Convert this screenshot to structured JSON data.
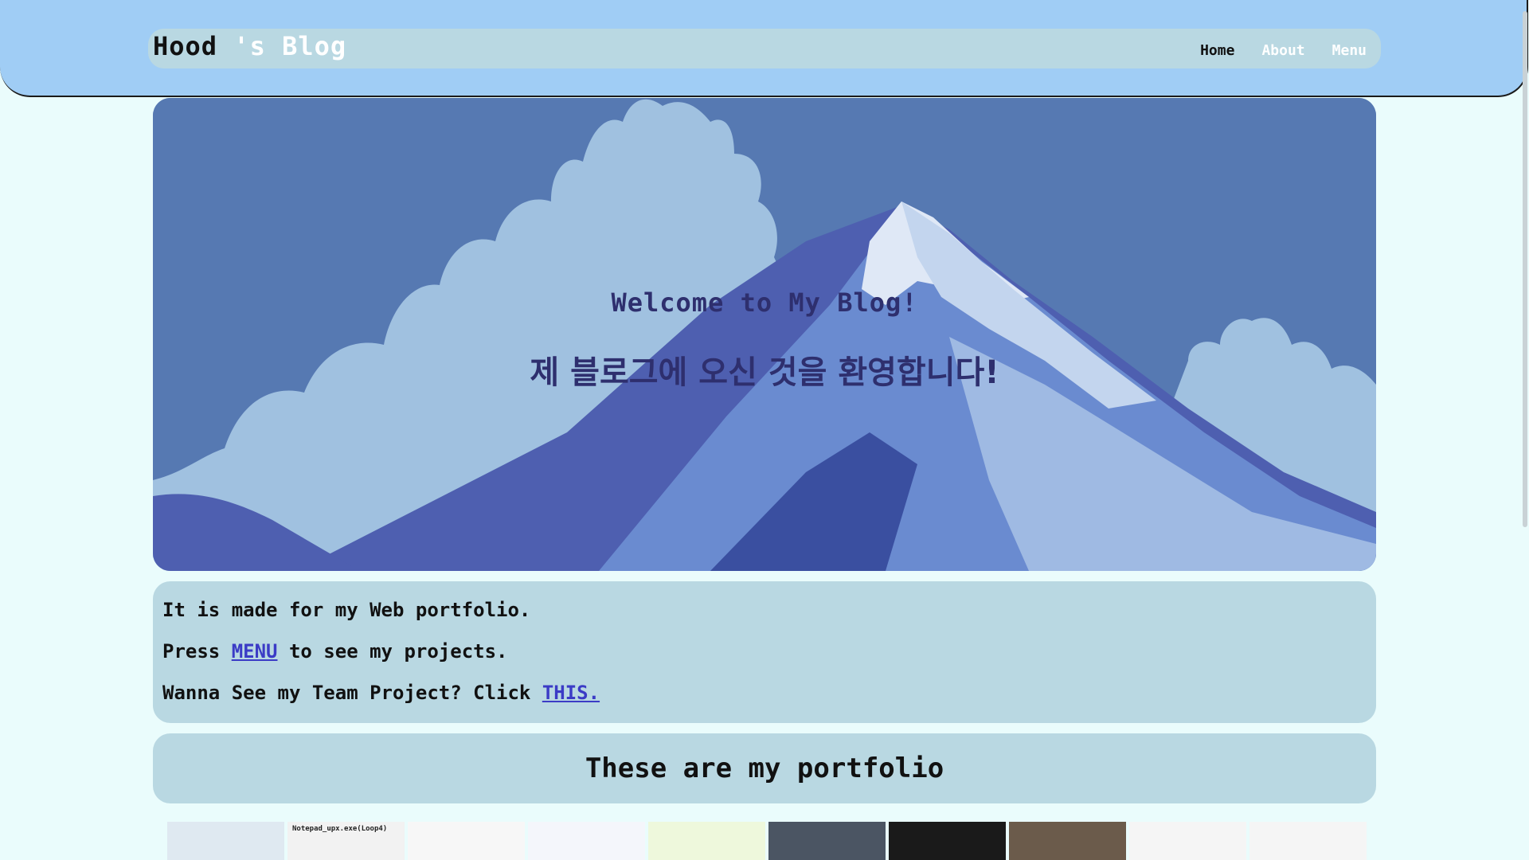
{
  "header": {
    "brand_name": "Hood",
    "brand_suffix": " 's Blog",
    "nav": [
      {
        "label": "Home",
        "active": true
      },
      {
        "label": "About",
        "active": false
      },
      {
        "label": "Menu",
        "active": false
      }
    ]
  },
  "hero": {
    "title": "Welcome to My Blog!",
    "subtitle": "제 블로그에 오신 것을 환영합니다!"
  },
  "intro": {
    "line1": "It is made for my Web portfolio.",
    "line2_before": "Press ",
    "line2_link": "MENU",
    "line2_after": " to see my projects.",
    "line3_before": "Wanna See my Team Project? Click ",
    "line3_link": "THIS."
  },
  "portfolio": {
    "heading": "These are my portfolio",
    "thumbnails": [
      {
        "caption": "",
        "color": "#dfe9f1"
      },
      {
        "caption": "Notepad_upx.exe(Loop4)",
        "color": "#f2f2f2"
      },
      {
        "caption": "",
        "color": "#f7f7f7"
      },
      {
        "caption": "",
        "color": "#f4f6fb"
      },
      {
        "caption": "",
        "color": "#eef8dc"
      },
      {
        "caption": "",
        "color": "#4b5563"
      },
      {
        "caption": "",
        "color": "#1a1a1a"
      },
      {
        "caption": "",
        "color": "#6b5b4b"
      },
      {
        "caption": "",
        "color": "#f5f5f5"
      },
      {
        "caption": "",
        "color": "#f5f5f5"
      }
    ]
  },
  "colors": {
    "header_bg": "#a0cdf5",
    "panel_bg": "#b9d8e2",
    "page_bg": "#eafcfc",
    "link": "#3b3bc6",
    "hero_text": "#2e2f6e"
  }
}
